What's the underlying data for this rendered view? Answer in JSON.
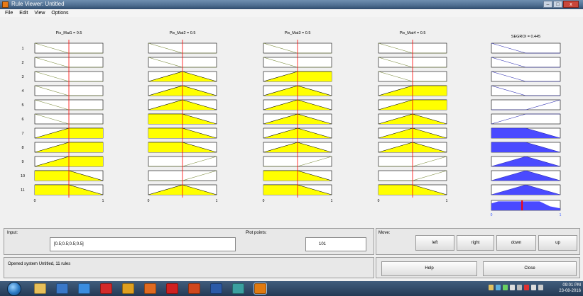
{
  "window": {
    "title": "Rule Viewer: Untitled",
    "minimize": "–",
    "maximize": "□",
    "close": "x"
  },
  "menu": [
    "File",
    "Edit",
    "View",
    "Options"
  ],
  "inputs": [
    {
      "label": "Pix_Mat1 = 0.5",
      "value": 0.5
    },
    {
      "label": "Pix_Mat2 = 0.5",
      "value": 0.5
    },
    {
      "label": "Pix_Mat3 = 0.5",
      "value": 0.5
    },
    {
      "label": "Pix_Mat4 = 0.5",
      "value": 0.5
    }
  ],
  "output": {
    "label": "SEGROI = 0.445",
    "value": 0.445
  },
  "rule_numbers": [
    "1",
    "2",
    "3",
    "4",
    "5",
    "6",
    "7",
    "8",
    "9",
    "10",
    "11"
  ],
  "axis_ticks": {
    "min": "0",
    "max": "1"
  },
  "colors": {
    "input_fill": "#ffff00",
    "output_fill": "#4a4aff",
    "indicator": "#ff0000",
    "mf_line": "#000000"
  },
  "rules": [
    {
      "mfs": [
        "low",
        "low",
        "low",
        "low"
      ],
      "out": "low",
      "out_fill": 0.0
    },
    {
      "mfs": [
        "low",
        "low",
        "low",
        "low"
      ],
      "out": "low",
      "out_fill": 0.0
    },
    {
      "mfs": [
        "low",
        "mid",
        "rise",
        "low"
      ],
      "out": "low",
      "out_fill": 0.0
    },
    {
      "mfs": [
        "low",
        "mid",
        "mid",
        "rise"
      ],
      "out": "low",
      "out_fill": 0.0
    },
    {
      "mfs": [
        "low",
        "mid",
        "mid",
        "rise"
      ],
      "out": "high",
      "out_fill": 0.0
    },
    {
      "mfs": [
        "low",
        "fall",
        "mid",
        "mid"
      ],
      "out": "rise",
      "out_fill": 0.0
    },
    {
      "mfs": [
        "rise",
        "fall",
        "mid",
        "mid"
      ],
      "out": "fall",
      "out_fill": 1.0
    },
    {
      "mfs": [
        "rise",
        "fall",
        "mid",
        "mid"
      ],
      "out": "fall",
      "out_fill": 1.0
    },
    {
      "mfs": [
        "rise",
        "high",
        "high",
        "high"
      ],
      "out": "mid",
      "out_fill": 1.0
    },
    {
      "mfs": [
        "fall",
        "high",
        "fall",
        "high"
      ],
      "out": "mid",
      "out_fill": 1.0
    },
    {
      "mfs": [
        "fall",
        "mid",
        "fall",
        "fall"
      ],
      "out": "mid",
      "out_fill": 1.0
    }
  ],
  "bottom": {
    "input_label": "Input:",
    "input_value": "[0.5;0.5;0.5;0.5]",
    "plot_points_label": "Plot points:",
    "plot_points_value": "101",
    "move_label": "Move:",
    "move_buttons": [
      "left",
      "right",
      "down",
      "up"
    ],
    "status": "Opened system Untitled, 11 rules",
    "help": "Help",
    "close": "Close"
  },
  "taskbar": {
    "icons": [
      "windows-explorer-icon",
      "media-player-icon",
      "internet-explorer-icon",
      "opera-icon",
      "chrome-icon",
      "firefox-icon",
      "acrobat-icon",
      "powerpoint-icon",
      "word-icon",
      "app-icon",
      "matlab-icon"
    ],
    "icon_colors": [
      "#e8c05a",
      "#3a78c8",
      "#3a8de0",
      "#d42a2a",
      "#e0a020",
      "#e06a20",
      "#d02020",
      "#d0471c",
      "#2a5aa8",
      "#3aa0a0",
      "#e07a10"
    ],
    "time": "09:01 PM",
    "date": "23-08-2016"
  }
}
